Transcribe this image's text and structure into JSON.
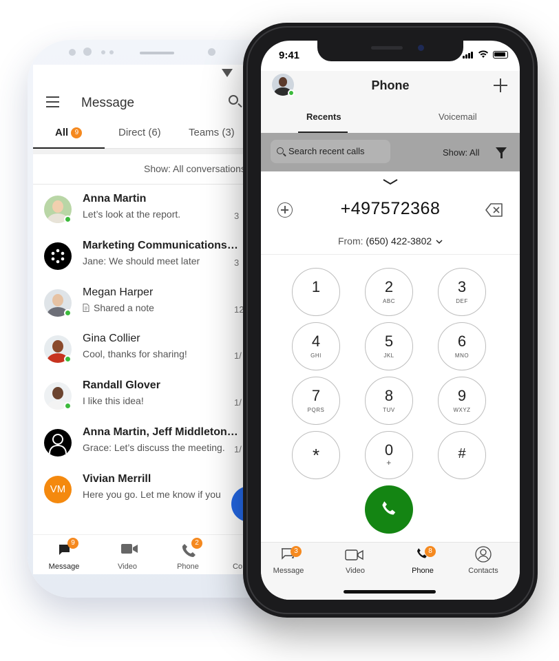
{
  "android": {
    "app_title": "Message",
    "tabs": [
      {
        "label": "All",
        "badge": "9"
      },
      {
        "label": "Direct (6)"
      },
      {
        "label": "Teams (3)"
      }
    ],
    "filter_label": "Show: All conversations",
    "conversations": [
      {
        "name": "Anna Martin",
        "preview": "Let’s look at the report.",
        "time": "3",
        "bold": true
      },
      {
        "name": "Marketing Communications",
        "preview": "Jane: We should meet later",
        "time": "3",
        "bold": true
      },
      {
        "name": "Megan Harper",
        "preview": "Shared a note",
        "time": "12",
        "bold": false
      },
      {
        "name": "Gina Collier",
        "preview": "Cool, thanks for sharing!",
        "time": "1/",
        "bold": false
      },
      {
        "name": "Randall Glover",
        "preview": "I like this idea!",
        "time": "1/",
        "bold": true
      },
      {
        "name": "Anna Martin, Jeff Middleton",
        "preview": "Grace: Let’s discuss the meeting.",
        "time": "1/",
        "bold": true
      },
      {
        "name": "Vivian Merrill",
        "preview": "Here you go. Let me know if you",
        "time": "1/",
        "bold": true,
        "initials": "VM"
      }
    ],
    "bottom_nav": [
      {
        "label": "Message",
        "badge": "9",
        "icon": "message-icon"
      },
      {
        "label": "Video",
        "icon": "video-icon"
      },
      {
        "label": "Phone",
        "badge": "2",
        "icon": "phone-icon"
      },
      {
        "label": "Co",
        "icon": "contacts-icon"
      }
    ],
    "colors": {
      "badge": "#f5891f",
      "online": "#3cba3c",
      "fab": "#2468e6"
    }
  },
  "iphone": {
    "status_time": "9:41",
    "title": "Phone",
    "tabs": [
      {
        "label": "Recents"
      },
      {
        "label": "Voicemail"
      }
    ],
    "search_placeholder": "Search recent calls",
    "show_filter": "Show: All",
    "dialed_number": "+497572368",
    "from_label": "From:",
    "from_number": "(650) 422-3802",
    "keypad": [
      {
        "digit": "1",
        "letters": ""
      },
      {
        "digit": "2",
        "letters": "ABC"
      },
      {
        "digit": "3",
        "letters": "DEF"
      },
      {
        "digit": "4",
        "letters": "GHI"
      },
      {
        "digit": "5",
        "letters": "JKL"
      },
      {
        "digit": "6",
        "letters": "MNO"
      },
      {
        "digit": "7",
        "letters": "PQRS"
      },
      {
        "digit": "8",
        "letters": "TUV"
      },
      {
        "digit": "9",
        "letters": "WXYZ"
      },
      {
        "digit": "*",
        "letters": ""
      },
      {
        "digit": "0",
        "letters": "+"
      },
      {
        "digit": "#",
        "letters": ""
      }
    ],
    "tab_bar": [
      {
        "label": "Message",
        "badge": "3",
        "icon": "message-icon"
      },
      {
        "label": "Video",
        "icon": "video-icon"
      },
      {
        "label": "Phone",
        "badge": "8",
        "icon": "phone-icon"
      },
      {
        "label": "Contacts",
        "icon": "contacts-icon"
      }
    ],
    "colors": {
      "call_button": "#148513",
      "badge": "#f5891f"
    }
  }
}
